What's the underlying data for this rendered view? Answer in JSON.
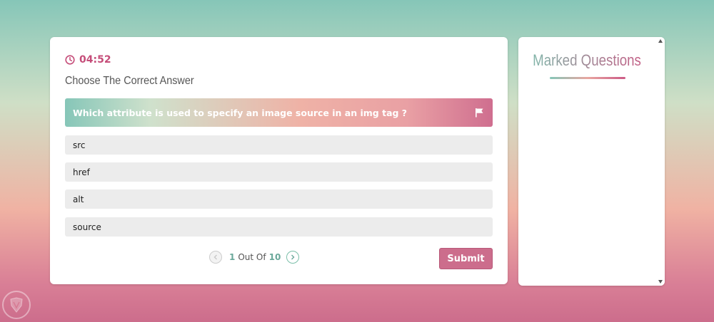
{
  "timer": {
    "value": "04:52"
  },
  "quiz": {
    "title": "Choose The Correct Answer",
    "question": "Which attribute is used to specify an image source in an img tag ?",
    "options": [
      "src",
      "href",
      "alt",
      "source"
    ]
  },
  "pager": {
    "current": "1",
    "separator": "Out Of",
    "total": "10"
  },
  "submit_label": "Submit",
  "marked": {
    "title": "Marked Questions"
  },
  "colors": {
    "accent": "#cc6d8c",
    "teal": "#86c6b8"
  },
  "icons": {
    "timer": "clock-icon",
    "flag": "flag-icon",
    "prev": "chevron-left-icon",
    "next": "chevron-right-icon"
  }
}
